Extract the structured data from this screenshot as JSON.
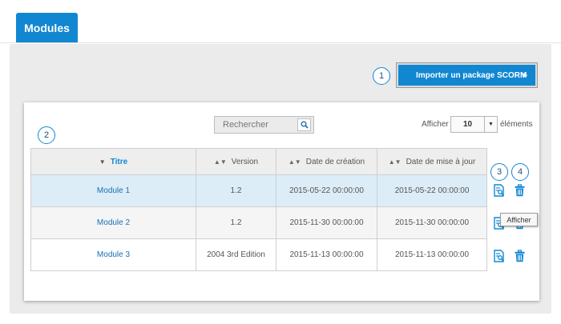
{
  "header": {
    "tab_label": "Modules"
  },
  "toolbar": {
    "import_label": "Importer un package SCORM"
  },
  "callouts": [
    "1",
    "2",
    "3",
    "4"
  ],
  "search": {
    "placeholder": "Rechercher"
  },
  "page_size": {
    "prefix": "Afficher",
    "value": "10",
    "suffix": "éléments"
  },
  "table": {
    "columns": [
      "Titre",
      "Version",
      "Date de création",
      "Date de mise à jour"
    ],
    "rows": [
      {
        "title": "Module 1",
        "version": "1.2",
        "created": "2015-05-22 00:00:00",
        "updated": "2015-05-22 00:00:00"
      },
      {
        "title": "Module 2",
        "version": "1.2",
        "created": "2015-11-30 00:00:00",
        "updated": "2015-11-30 00:00:00"
      },
      {
        "title": "Module 3",
        "version": "2004 3rd Edition",
        "created": "2015-11-13 00:00:00",
        "updated": "2015-11-13 00:00:00"
      }
    ]
  },
  "tooltip": {
    "text": "Afficher"
  },
  "icons": {
    "view": "view-document-icon",
    "delete": "trash-icon",
    "search": "search-icon"
  },
  "colors": {
    "accent": "#1187d2",
    "selected_row": "#dcedf8"
  }
}
